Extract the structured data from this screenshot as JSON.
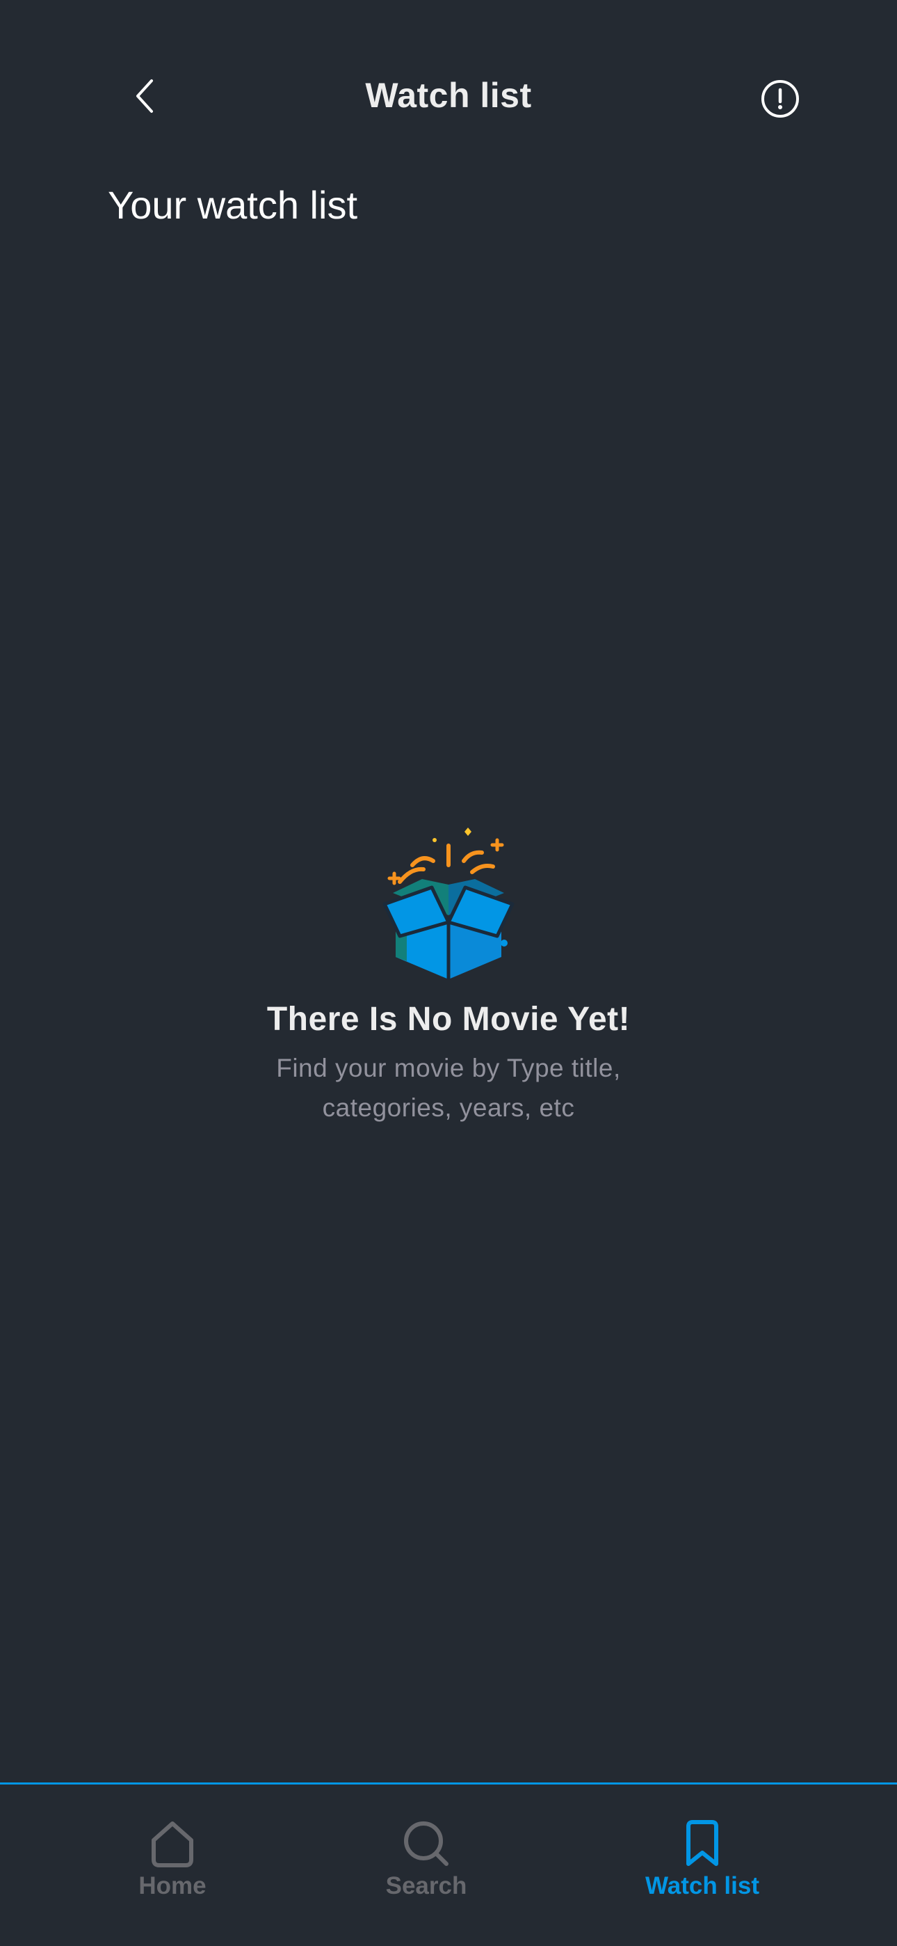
{
  "header": {
    "title": "Watch list",
    "back_icon": "chevron-left-icon",
    "info_icon": "info-circle-icon"
  },
  "section": {
    "title": "Your watch list"
  },
  "empty_state": {
    "icon": "open-box-icon",
    "title": "There Is No Movie Yet!",
    "subtitle": "Find your movie by Type title, categories, years, etc"
  },
  "bottom_nav": {
    "items": [
      {
        "label": "Home",
        "icon": "home-icon",
        "active": false
      },
      {
        "label": "Search",
        "icon": "search-icon",
        "active": false
      },
      {
        "label": "Watch list",
        "icon": "bookmark-icon",
        "active": true
      }
    ]
  },
  "colors": {
    "background": "#242A32",
    "accent": "#0296E5",
    "inactive": "#67686D",
    "muted_text": "#92929D"
  }
}
